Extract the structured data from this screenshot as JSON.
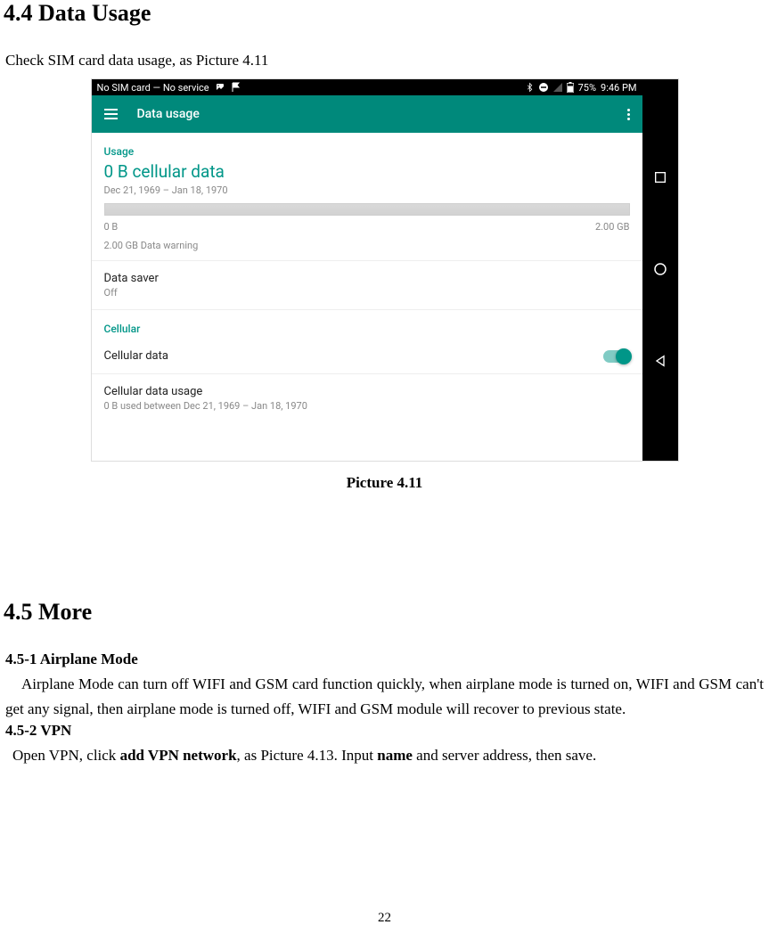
{
  "section44": {
    "title": "4.4 Data Usage",
    "intro": "Check SIM card data usage, as Picture 4.11"
  },
  "screenshot": {
    "status": {
      "sim": "No SIM card — No service",
      "battery": "75%",
      "time": "9:46 PM"
    },
    "appbar": {
      "title": "Data usage"
    },
    "usage": {
      "label": "Usage",
      "main_value": "0 B cellular data",
      "date_range": "Dec 21, 1969 – Jan 18, 1970",
      "bar_min": "0 B",
      "bar_max": "2.00 GB",
      "warning": "2.00 GB Data warning"
    },
    "datasaver": {
      "title": "Data saver",
      "status": "Off"
    },
    "cellular": {
      "label": "Cellular",
      "toggle_title": "Cellular data",
      "usage_title": "Cellular data usage",
      "usage_sub": "0 B used between Dec 21, 1969 – Jan 18, 1970"
    }
  },
  "picture_caption": "Picture 4.11",
  "section45": {
    "title": "4.5 More",
    "sub1_title": "4.5-1 Airplane Mode",
    "sub1_body": "Airplane Mode can turn off WIFI and GSM card function quickly, when airplane mode is turned on, WIFI and GSM can't get any signal, then airplane mode is turned off, WIFI and GSM module will recover to previous state.",
    "sub2_title": "4.5-2 VPN",
    "sub2_pre": "Open VPN, click ",
    "sub2_bold1": "add VPN network",
    "sub2_mid": ", as Picture 4.13. Input ",
    "sub2_bold2": "name",
    "sub2_post": " and server address, then save."
  },
  "page_number": "22"
}
